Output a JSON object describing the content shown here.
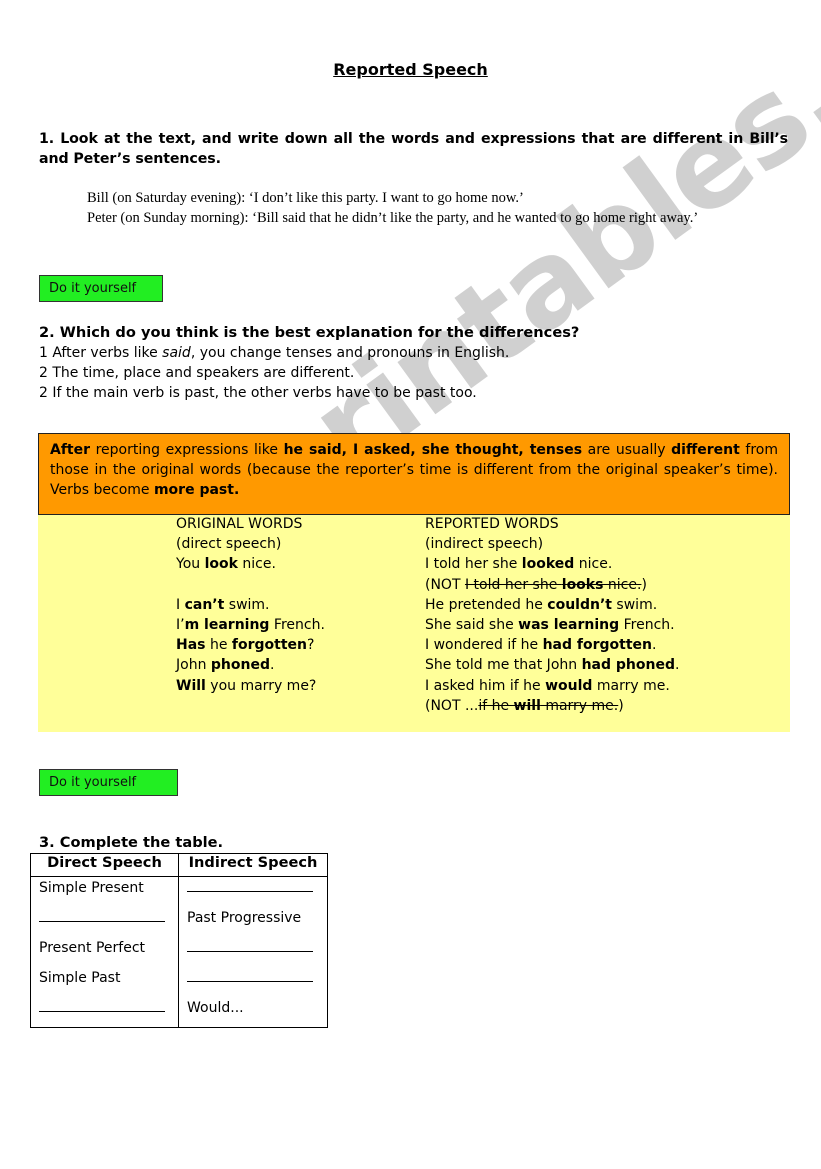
{
  "title": "Reported Speech",
  "section1": {
    "heading": "1. Look at the text, and write down all the words and expressions that are different in Bill’s and Peter’s sentences.",
    "bill_line": "Bill (on Saturday evening): ‘I don’t like this party. I want to go home now.’",
    "peter_line": "Peter (on Sunday morning): ‘Bill said that he didn’t like the party, and he wanted to go home right away.’"
  },
  "diy_button_label": "Do it yourself",
  "section2": {
    "heading": "2. Which do you think is the best explanation for the differences?",
    "option1_prefix": "1 After verbs like ",
    "option1_italic": "said",
    "option1_suffix": ", you change tenses and pronouns in English.",
    "option2": "2 The time, place and speakers are different.",
    "option3": "2 If the main verb is past, the other verbs have to be past too."
  },
  "rule_box": {
    "p1_bold": "After",
    "p2": " reporting expressions like ",
    "p3_bold": "he said, I asked, she thought, tenses",
    "p4": " are usually ",
    "p5_bold": "different",
    "p6": " from those in the original words (because the reporter’s time is different from the original speaker’s time). Verbs become ",
    "p7_bold": "more past."
  },
  "examples": {
    "original_header": "ORIGINAL WORDS",
    "original_sub": "(direct speech)",
    "reported_header": "REPORTED WORDS",
    "reported_sub": "(indirect speech)",
    "orig": [
      {
        "a": "You ",
        "b": "look",
        "c": " nice."
      },
      {
        "a": "I ",
        "b": "can’t",
        "c": " swim."
      },
      {
        "a": "I’",
        "b": "m learning",
        "c": " French."
      },
      {
        "a": "",
        "b": "Has",
        "c": " he ",
        "d": "forgotten",
        "e": "?"
      },
      {
        "a": "John ",
        "b": "phoned",
        "c": "."
      },
      {
        "a": "",
        "b": "Will",
        "c": " you marry me?"
      }
    ],
    "rep": [
      {
        "a": "I told her she ",
        "b": "looked",
        "c": " nice."
      },
      {
        "a": "(NOT ",
        "s1": "I told her she ",
        "sb": "looks",
        "s2": " nice.",
        "c": ")"
      },
      {
        "a": "He pretended he ",
        "b": "couldn’t",
        "c": " swim."
      },
      {
        "a": "She said she ",
        "b": "was learning",
        "c": " French."
      },
      {
        "a": "I wondered if he ",
        "b": "had forgotten",
        "c": "."
      },
      {
        "a": "She told me that John ",
        "b": "had phoned",
        "c": "."
      },
      {
        "a": "I asked him if he ",
        "b": "would",
        "c": " marry me."
      },
      {
        "a": "(NOT ...",
        "s1": "if he ",
        "sb": "will",
        "s2": " marry me.",
        "c": ")"
      }
    ]
  },
  "section3": {
    "heading": "3. Complete the table.",
    "col_direct": "Direct Speech",
    "col_indirect": "Indirect Speech",
    "direct": [
      "Simple Present",
      "",
      "Present Perfect",
      "Simple Past",
      ""
    ],
    "indirect": [
      "",
      "Past Progressive",
      "",
      "",
      "Would..."
    ]
  },
  "watermark": "ESLprintables.com"
}
